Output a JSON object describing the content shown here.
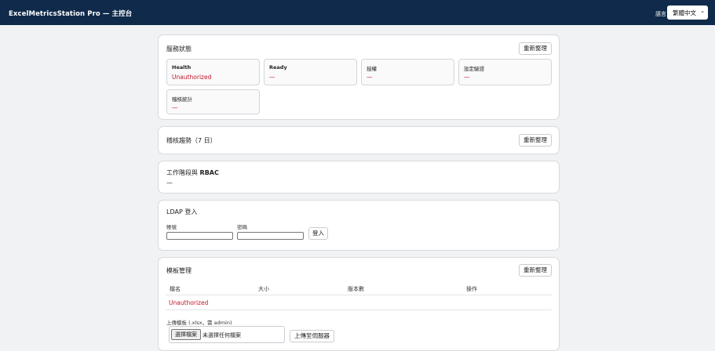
{
  "header": {
    "title": "ExcelMetricsStation Pro — 主控台",
    "language_label": "語言",
    "language_value": "繁體中文"
  },
  "status": {
    "title": "服務狀態",
    "refresh_label": "重新整理",
    "cards": [
      {
        "label": "Health",
        "value": "Unauthorized"
      },
      {
        "label": "Ready",
        "value": "—"
      },
      {
        "label": "授權",
        "value": "—"
      },
      {
        "label": "設定驗證",
        "value": "—"
      },
      {
        "label": "稽核統計",
        "value": "—"
      }
    ]
  },
  "trend": {
    "title": "稽核趨勢（7 日）",
    "refresh_label": "重新整理"
  },
  "session": {
    "title_prefix": "工作階段與 ",
    "title_suffix": "RBAC",
    "value": "—"
  },
  "ldap": {
    "title": "LDAP 登入",
    "account_label": "帳號",
    "password_label": "密碼",
    "login_label": "登入"
  },
  "templates": {
    "title": "模板管理",
    "refresh_label": "重新整理",
    "columns": [
      "檔名",
      "大小",
      "版本數",
      "操作"
    ],
    "error_row": "Unauthorized",
    "upload_label": "上傳模板 (.xlsx，需 admin)",
    "choose_file_label": "選擇檔案",
    "no_file_label": "未選擇任何檔案",
    "upload_button": "上傳至伺服器"
  }
}
